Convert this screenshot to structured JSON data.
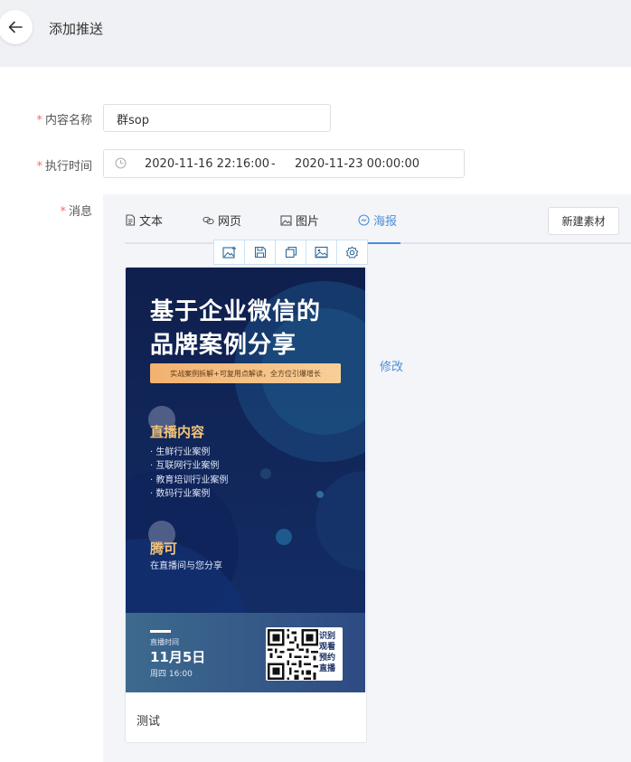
{
  "header": {
    "title": "添加推送"
  },
  "form": {
    "name_label": "内容名称",
    "name_value": "群sop",
    "time_label": "执行时间",
    "date_start": "2020-11-16 22:16:00",
    "date_separator": "-",
    "date_end": "2020-11-23 00:00:00",
    "message_label": "消息",
    "required_mark": "*"
  },
  "tabs": [
    {
      "label": "文本",
      "icon": "document-icon"
    },
    {
      "label": "网页",
      "icon": "link-icon"
    },
    {
      "label": "图片",
      "icon": "image-icon"
    },
    {
      "label": "海报",
      "icon": "poster-icon",
      "active": true
    }
  ],
  "new_material_button": "新建素材",
  "poster_toolbar": [
    "add-image-icon",
    "save-icon",
    "copy-icon",
    "picture-icon",
    "settings-icon"
  ],
  "edit_link": "修改",
  "poster_card": {
    "caption": "测试",
    "title_line1": "基于企业微信的",
    "title_line2": "品牌案例分享",
    "banner": "实战案例拆解+可复用点解读，全方位引爆增长",
    "section1_title": "直播内容",
    "section1_items": [
      "· 生鲜行业案例",
      "· 互联网行业案例",
      "· 教育培训行业案例",
      "· 数码行业案例"
    ],
    "section2_title": "腾可",
    "section2_text": "在直播间与您分享",
    "live_label": "直播时间",
    "live_date": "11月5日",
    "live_time": "周四 16:00",
    "qr_caption": "识别观看预约直播"
  },
  "colors": {
    "accent": "#4a8fd8",
    "required": "#f56c6c",
    "poster_bg": "#12265a",
    "poster_gold": "#f3c37a"
  }
}
